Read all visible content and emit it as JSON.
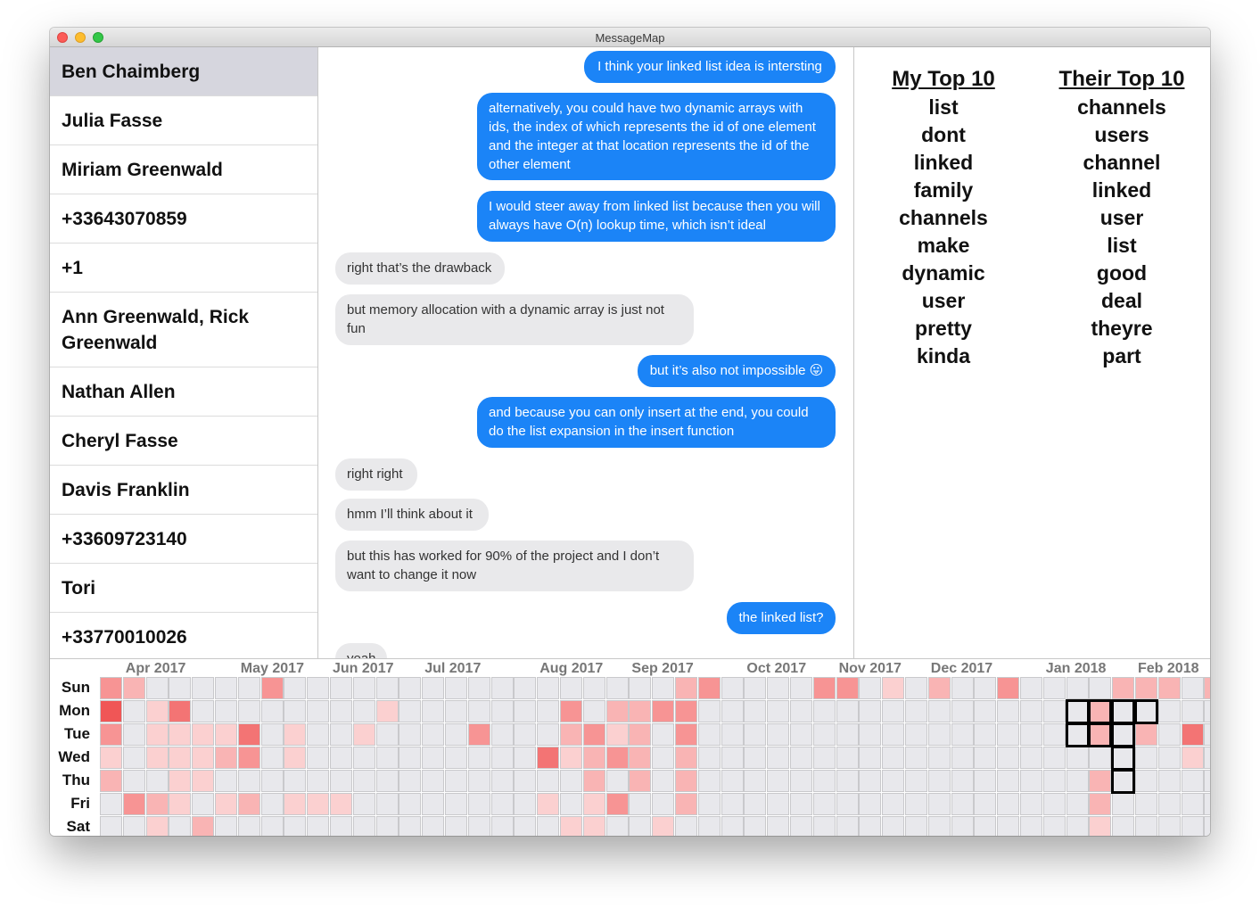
{
  "window": {
    "title": "MessageMap"
  },
  "contacts": [
    "Ben Chaimberg",
    "Julia Fasse",
    "Miriam Greenwald",
    "+33643070859",
    "+1",
    "Ann Greenwald, Rick Greenwald",
    "Nathan Allen",
    "Cheryl Fasse",
    "Davis Franklin",
    "+33609723140",
    "Tori",
    "+33770010026"
  ],
  "selected_contact_index": 0,
  "messages": [
    {
      "from": "me",
      "text": "I think your linked list idea is intersting"
    },
    {
      "from": "me",
      "text": "alternatively, you could have two dynamic arrays with ids, the index of which represents the id of one element and the integer at that location represents the id of the other element"
    },
    {
      "from": "me",
      "text": "I would steer away from linked list because then you will always have O(n) lookup time, which isn’t ideal"
    },
    {
      "from": "them",
      "text": "right that’s the drawback"
    },
    {
      "from": "them",
      "text": "but memory allocation with a dynamic array is just not fun"
    },
    {
      "from": "me",
      "text": "but it’s also not impossible 😛"
    },
    {
      "from": "me",
      "text": "and because you can only insert at the end, you could do the list expansion in the insert function"
    },
    {
      "from": "them",
      "text": "right right"
    },
    {
      "from": "them",
      "text": "hmm I’ll think about it"
    },
    {
      "from": "them",
      "text": "but this has worked for 90% of the project and I don’t want to change it now"
    },
    {
      "from": "me",
      "text": "the linked list?"
    },
    {
      "from": "them",
      "text": "yeah"
    }
  ],
  "top10": {
    "mine": {
      "title": "My Top 10",
      "words": [
        "list",
        "dont",
        "linked",
        "family",
        "channels",
        "make",
        "dynamic",
        "user",
        "pretty",
        "kinda"
      ]
    },
    "theirs": {
      "title": "Their Top 10",
      "words": [
        "channels",
        "users",
        "channel",
        "linked",
        "user",
        "list",
        "good",
        "deal",
        "theyre",
        "part"
      ]
    }
  },
  "heatmap": {
    "days": [
      "Sun",
      "Mon",
      "Tue",
      "Wed",
      "Thu",
      "Fri",
      "Sat"
    ],
    "months": [
      {
        "label": "Apr 2017",
        "week": 1
      },
      {
        "label": "May 2017",
        "week": 6
      },
      {
        "label": "Jun 2017",
        "week": 10
      },
      {
        "label": "Jul 2017",
        "week": 14
      },
      {
        "label": "Aug 2017",
        "week": 19
      },
      {
        "label": "Sep 2017",
        "week": 23
      },
      {
        "label": "Oct 2017",
        "week": 28
      },
      {
        "label": "Nov 2017",
        "week": 32
      },
      {
        "label": "Dec 2017",
        "week": 36
      },
      {
        "label": "Jan 2018",
        "week": 41
      },
      {
        "label": "Feb 2018",
        "week": 45
      }
    ],
    "colors": {
      "empty": "#e8e8ec",
      "levels": [
        "#e8e8ec",
        "#fbd0d0",
        "#f9b4b4",
        "#f79494",
        "#f37474",
        "#f05656"
      ]
    },
    "rows": [
      "3200000300000000000000000230000330102003000022202100002000",
      "5014000000001000000030223300000000000000000200000300030000",
      "3011114010010000300023120300000000000000000202040000030000",
      "1011123010000000000412320200000000000000000000010000030000",
      "2001100000000000000002020200000000000000000200000000000000",
      "0321012011100000000101300200000000000000000200000000000000",
      "0010200000000000000011001000000000000000000100000000000000"
    ],
    "overrides": {
      "note": ""
    },
    "highlight": [
      [
        1,
        42
      ],
      [
        1,
        43
      ],
      [
        1,
        44
      ],
      [
        1,
        45
      ],
      [
        2,
        42
      ],
      [
        2,
        43
      ],
      [
        2,
        44
      ],
      [
        3,
        44
      ],
      [
        4,
        44
      ]
    ]
  }
}
